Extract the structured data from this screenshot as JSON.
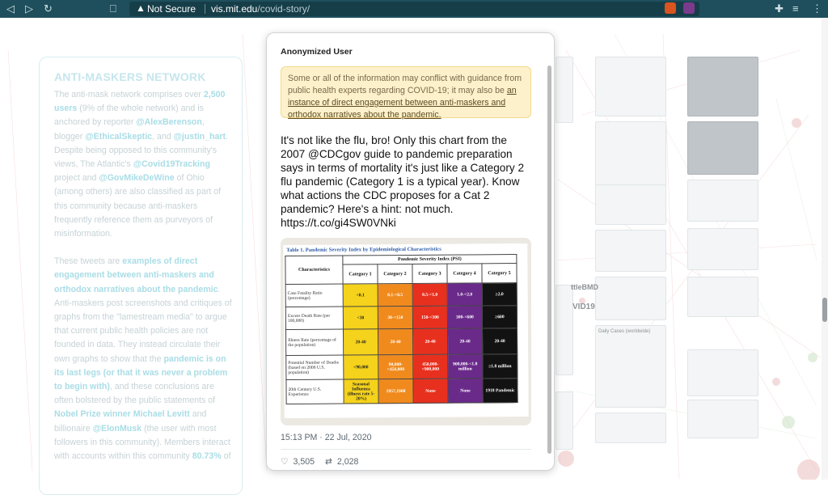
{
  "browser": {
    "security_label": "Not Secure",
    "host": "vis.mit.edu",
    "path": "/covid-story/"
  },
  "left_panel": {
    "title": "ANTI-MASKERS NETWORK",
    "p1": {
      "a": "The anti-mask network comprises over ",
      "b": "2,500 users",
      "c": " (9% of the whole network) and is anchored by reporter ",
      "d": "@AlexBerenson",
      "e": ", blogger ",
      "f": "@EthicalSkeptic",
      "g": ", and ",
      "h": "@justin_hart",
      "i": ". Despite being opposed to this community's views, The Atlantic's ",
      "j": "@Covid19Tracking",
      "k": " project and ",
      "l": "@GovMikeDeWine",
      "m": " of Ohio (among others) are also classified as part of this community because anti-maskers frequently reference them as purveyors of misinformation."
    },
    "p2": {
      "a": "These tweets are ",
      "b": "examples of direct engagement between anti-maskers and orthodox narratives about the pandemic",
      "c": ". Anti-maskers post screenshots and critiques of graphs from the \"lamestream media\" to argue that current public health policies are not founded in data. They instead circulate their own graphs to show that the ",
      "d": "pandemic is on its last legs (or that it was never a problem to begin with)",
      "e": ", and these conclusions are often bolstered by the public statements of ",
      "f": "Nobel Prize winner Michael Levitt",
      "g": " and billionaire ",
      "h": "@ElonMusk",
      "i": " (the user with most followers in this community). Members interact with accounts within this community ",
      "j": "80.73%",
      "k": " of"
    }
  },
  "tweet_card": {
    "user": "Anonymized User",
    "note_text": "Some or all of the information may conflict with guidance from public health experts regarding COVID-19; it may also be ",
    "note_link": "an instance of direct engagement between anti-maskers and orthodox narratives about the pandemic.",
    "tweet_text": "It's not like the flu, bro! Only this chart from the 2007 @CDCgov guide to pandemic preparation says in terms of mortality it's just like a Category 2 flu pandemic (Category 1 is a typical year). Know what actions the CDC proposes for a Cat 2 pandemic? Here's a hint: not much. https://t.co/gi4SW0VNki",
    "timestamp": "15:13 PM · 22 Jul, 2020",
    "likes": "3,505",
    "retweets": "2,028",
    "photo": {
      "caption": "Table 1. Pandemic Severity Index by Epidemiological Characteristics",
      "header_left": "Characteristics",
      "header_group": "Pandemic Severity Index (PSI)",
      "categories": [
        "Category 1",
        "Category 2",
        "Category 3",
        "Category 4",
        "Category 5"
      ],
      "rows": [
        {
          "label": "Case Fatality Ratio (percentage)",
          "cells": [
            "<0.1",
            "0.1-<0.5",
            "0.5-<1.0",
            "1.0-<2.0",
            "≥2.0"
          ]
        },
        {
          "label": "Excess Death Rate (per 100,000)",
          "cells": [
            "<30",
            "30-<150",
            "150-<300",
            "300-<600",
            "≥600"
          ]
        },
        {
          "label": "Illness Rate (percentage of the population)",
          "cells": [
            "20-40",
            "20-40",
            "20-40",
            "20-40",
            "20-40"
          ]
        },
        {
          "label": "Potential Number of Deaths (based on 2006 U.S. population)",
          "cells": [
            "<90,000",
            "90,000-<450,000",
            "450,000-<900,000",
            "900,000-<1.8 million",
            "≥1.8 million"
          ]
        },
        {
          "label": "20th Century U.S. Experience",
          "cells": [
            "Seasonal Influenza (illness rate 5-20%)",
            "1957,1968",
            "None",
            "None",
            "1918 Pandemic"
          ]
        }
      ]
    }
  },
  "background_labels": {
    "covid_label": "VID19",
    "handle_label": "ttleBMD",
    "dash_title": "Daily Cases (worldwide)"
  },
  "colors": {
    "accent_teal": "#a9dde6",
    "chrome_bg": "#1f4f5c",
    "note_bg": "#fdf1cc",
    "cat1": "#f5d21b",
    "cat2": "#f08a1d",
    "cat3": "#e8301f",
    "cat4": "#6a2a8a",
    "cat5": "#121212"
  }
}
